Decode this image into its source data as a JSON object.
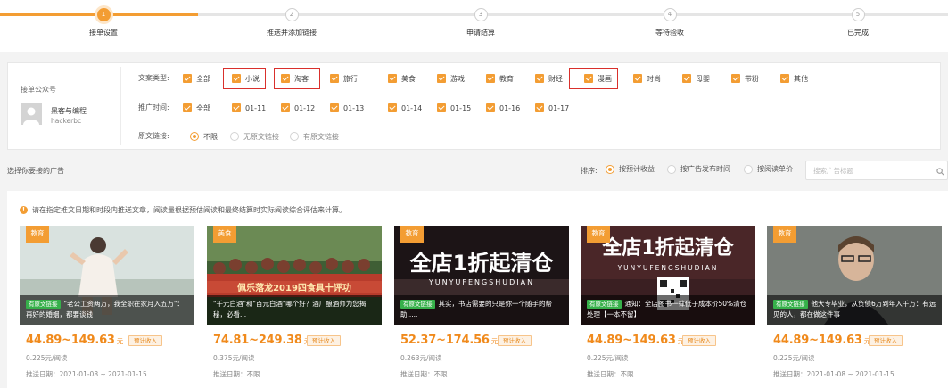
{
  "steps": [
    {
      "num": "1",
      "label": "接单设置"
    },
    {
      "num": "2",
      "label": "推送并添加链接"
    },
    {
      "num": "3",
      "label": "申请结算"
    },
    {
      "num": "4",
      "label": "等待验收"
    },
    {
      "num": "5",
      "label": "已完成"
    }
  ],
  "account": {
    "title": "接单公众号",
    "name": "黑客与编程",
    "id": "hackerbc"
  },
  "filters": {
    "category_label": "文案类型:",
    "categories": [
      "全部",
      "小说",
      "淘客",
      "旅行",
      "美食",
      "游戏",
      "教育",
      "财经",
      "漫画",
      "时尚",
      "母婴",
      "带粉",
      "其他"
    ],
    "time_label": "推广时间:",
    "times": [
      "全部",
      "01-11",
      "01-12",
      "01-13",
      "01-14",
      "01-15",
      "01-16",
      "01-17"
    ],
    "link_label": "原文链接:",
    "links": [
      "不限",
      "无原文链接",
      "有原文链接"
    ]
  },
  "sort": {
    "title": "选择你要接的广告",
    "label": "排序:",
    "options": [
      "按预计收益",
      "按广告发布时间",
      "按阅读单价"
    ],
    "search_placeholder": "搜索广告标题"
  },
  "notice": "请在指定推文日期和时段内推送文章，阅读量根据预估阅读和最终结算时实际阅读综合评估来计算。",
  "cards": [
    {
      "category": "教育",
      "original_tag": "有原文链接",
      "caption": "\"老公工资两万，我全职在家月入五万\"：再好的婚姻，都要谈钱",
      "price": "44.89~149.63",
      "unit": "元",
      "est": "预计收入",
      "rate": "0.225元/阅读",
      "date": "推送日期：2021-01-08 ~ 2021-01-15"
    },
    {
      "category": "美食",
      "original_tag": "",
      "caption": "\"千元白酒\"和\"百元白酒\"哪个好？酒厂酿酒师为您揭秘，必看...",
      "price": "74.81~249.38",
      "unit": "元",
      "est": "预计收入",
      "rate": "0.375元/阅读",
      "date": "推送日期：不限"
    },
    {
      "category": "教育",
      "original_tag": "有原文链接",
      "caption": "其实，书店需要的只是你一个随手的帮助.....",
      "price": "52.37~174.56",
      "unit": "元",
      "est": "预计收入",
      "rate": "0.263元/阅读",
      "date": "推送日期：不限"
    },
    {
      "category": "教育",
      "original_tag": "有原文链接",
      "caption": "通知：全店图书一律低于成本价50%清仓处理【一本不留】",
      "price": "44.89~149.63",
      "unit": "元",
      "est": "预计收入",
      "rate": "0.225元/阅读",
      "date": "推送日期：不限"
    },
    {
      "category": "教育",
      "original_tag": "有原文链接",
      "caption": "他大专毕业，从负债6万到年入千万：有远见的人，都在做这件事",
      "price": "44.89~149.63",
      "unit": "元",
      "est": "预计收入",
      "rate": "0.225元/阅读",
      "date": "推送日期：2021-01-08 ~ 2021-01-15"
    }
  ],
  "banner_text": {
    "line1": "全店1折起清仓",
    "line2": "YUNYUFENGSHUDIAN",
    "crowd": "佩乐落龙2019四食具十评功"
  },
  "colors": {
    "accent": "#f39d33",
    "red_highlight": "#d9302c",
    "tag_green": "#36b04a"
  }
}
